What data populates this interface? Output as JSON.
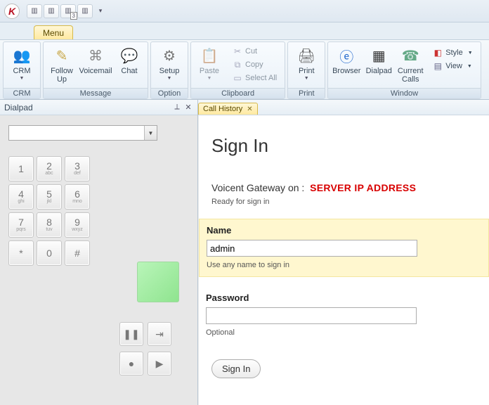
{
  "titlebar": {
    "qat_badge": "3"
  },
  "menu": {
    "tab_label": "Menu"
  },
  "ribbon": {
    "crm": {
      "btn": "CRM",
      "group": "CRM"
    },
    "message": {
      "followup": "Follow\nUp",
      "voicemail": "Voicemail",
      "chat": "Chat",
      "group": "Message"
    },
    "option": {
      "setup": "Setup",
      "group": "Option"
    },
    "clipboard": {
      "paste": "Paste",
      "cut": "Cut",
      "copy": "Copy",
      "selectall": "Select All",
      "group": "Clipboard"
    },
    "print": {
      "btn": "Print",
      "group": "Print"
    },
    "window": {
      "browser": "Browser",
      "dialpad": "Dialpad",
      "current": "Current\nCalls",
      "style": "Style",
      "view": "View",
      "group": "Window"
    }
  },
  "dialpad": {
    "title": "Dialpad",
    "keys": [
      {
        "n": "1",
        "l": ""
      },
      {
        "n": "2",
        "l": "abc"
      },
      {
        "n": "3",
        "l": "def"
      },
      {
        "n": "4",
        "l": "ghi"
      },
      {
        "n": "5",
        "l": "jkl"
      },
      {
        "n": "6",
        "l": "mno"
      },
      {
        "n": "7",
        "l": "pqrs"
      },
      {
        "n": "8",
        "l": "tuv"
      },
      {
        "n": "9",
        "l": "wxyz"
      },
      {
        "n": "*",
        "l": ""
      },
      {
        "n": "0",
        "l": ""
      },
      {
        "n": "#",
        "l": ""
      }
    ]
  },
  "doc": {
    "tab": "Call History"
  },
  "signin": {
    "heading": "Sign In",
    "gateway_prefix": "Voicent Gateway on :",
    "server": "SERVER IP ADDRESS",
    "ready": "Ready for sign in",
    "name_label": "Name",
    "name_value": "admin",
    "name_hint": "Use any name to sign in",
    "pwd_label": "Password",
    "pwd_value": "",
    "pwd_hint": "Optional",
    "button": "Sign In"
  }
}
